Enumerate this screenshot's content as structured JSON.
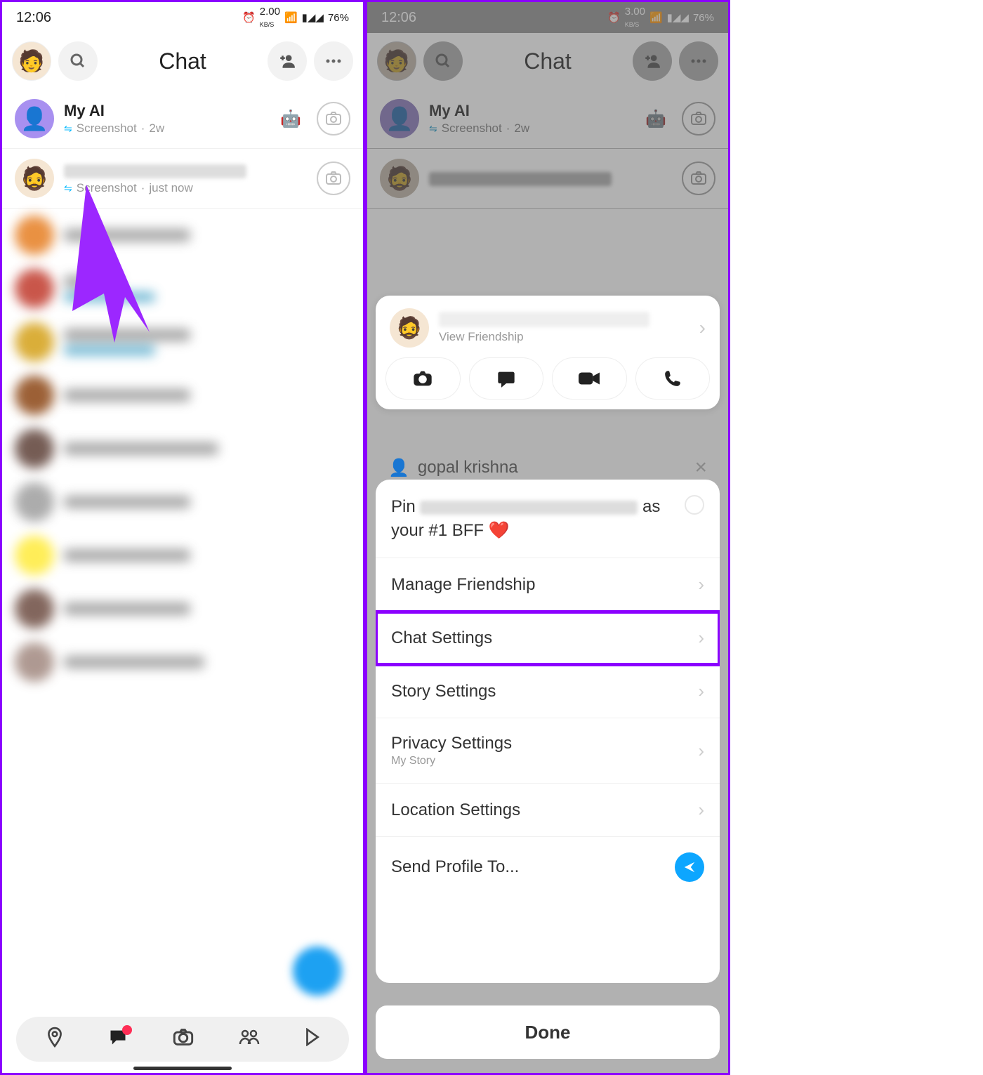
{
  "statusbar": {
    "time": "12:06",
    "kbs_left": "2.00",
    "kbs_right": "3.00",
    "kbs_unit": "KB/S",
    "battery": "76%"
  },
  "header": {
    "title": "Chat"
  },
  "chats": [
    {
      "name": "My AI",
      "status": "Screenshot",
      "time": "2w",
      "emoji": "🤖"
    },
    {
      "name": "",
      "status": "Screenshot",
      "time": "just now"
    }
  ],
  "friend_card": {
    "sub": "View Friendship"
  },
  "peek": {
    "name": "gopal krishna"
  },
  "options": {
    "pin_prefix": "Pin",
    "pin_suffix": "as your #1 BFF ❤️",
    "manage": "Manage Friendship",
    "chat_settings": "Chat Settings",
    "story_settings": "Story Settings",
    "privacy_settings": "Privacy Settings",
    "privacy_sub": "My Story",
    "location_settings": "Location Settings",
    "send_profile": "Send Profile To..."
  },
  "done": "Done"
}
